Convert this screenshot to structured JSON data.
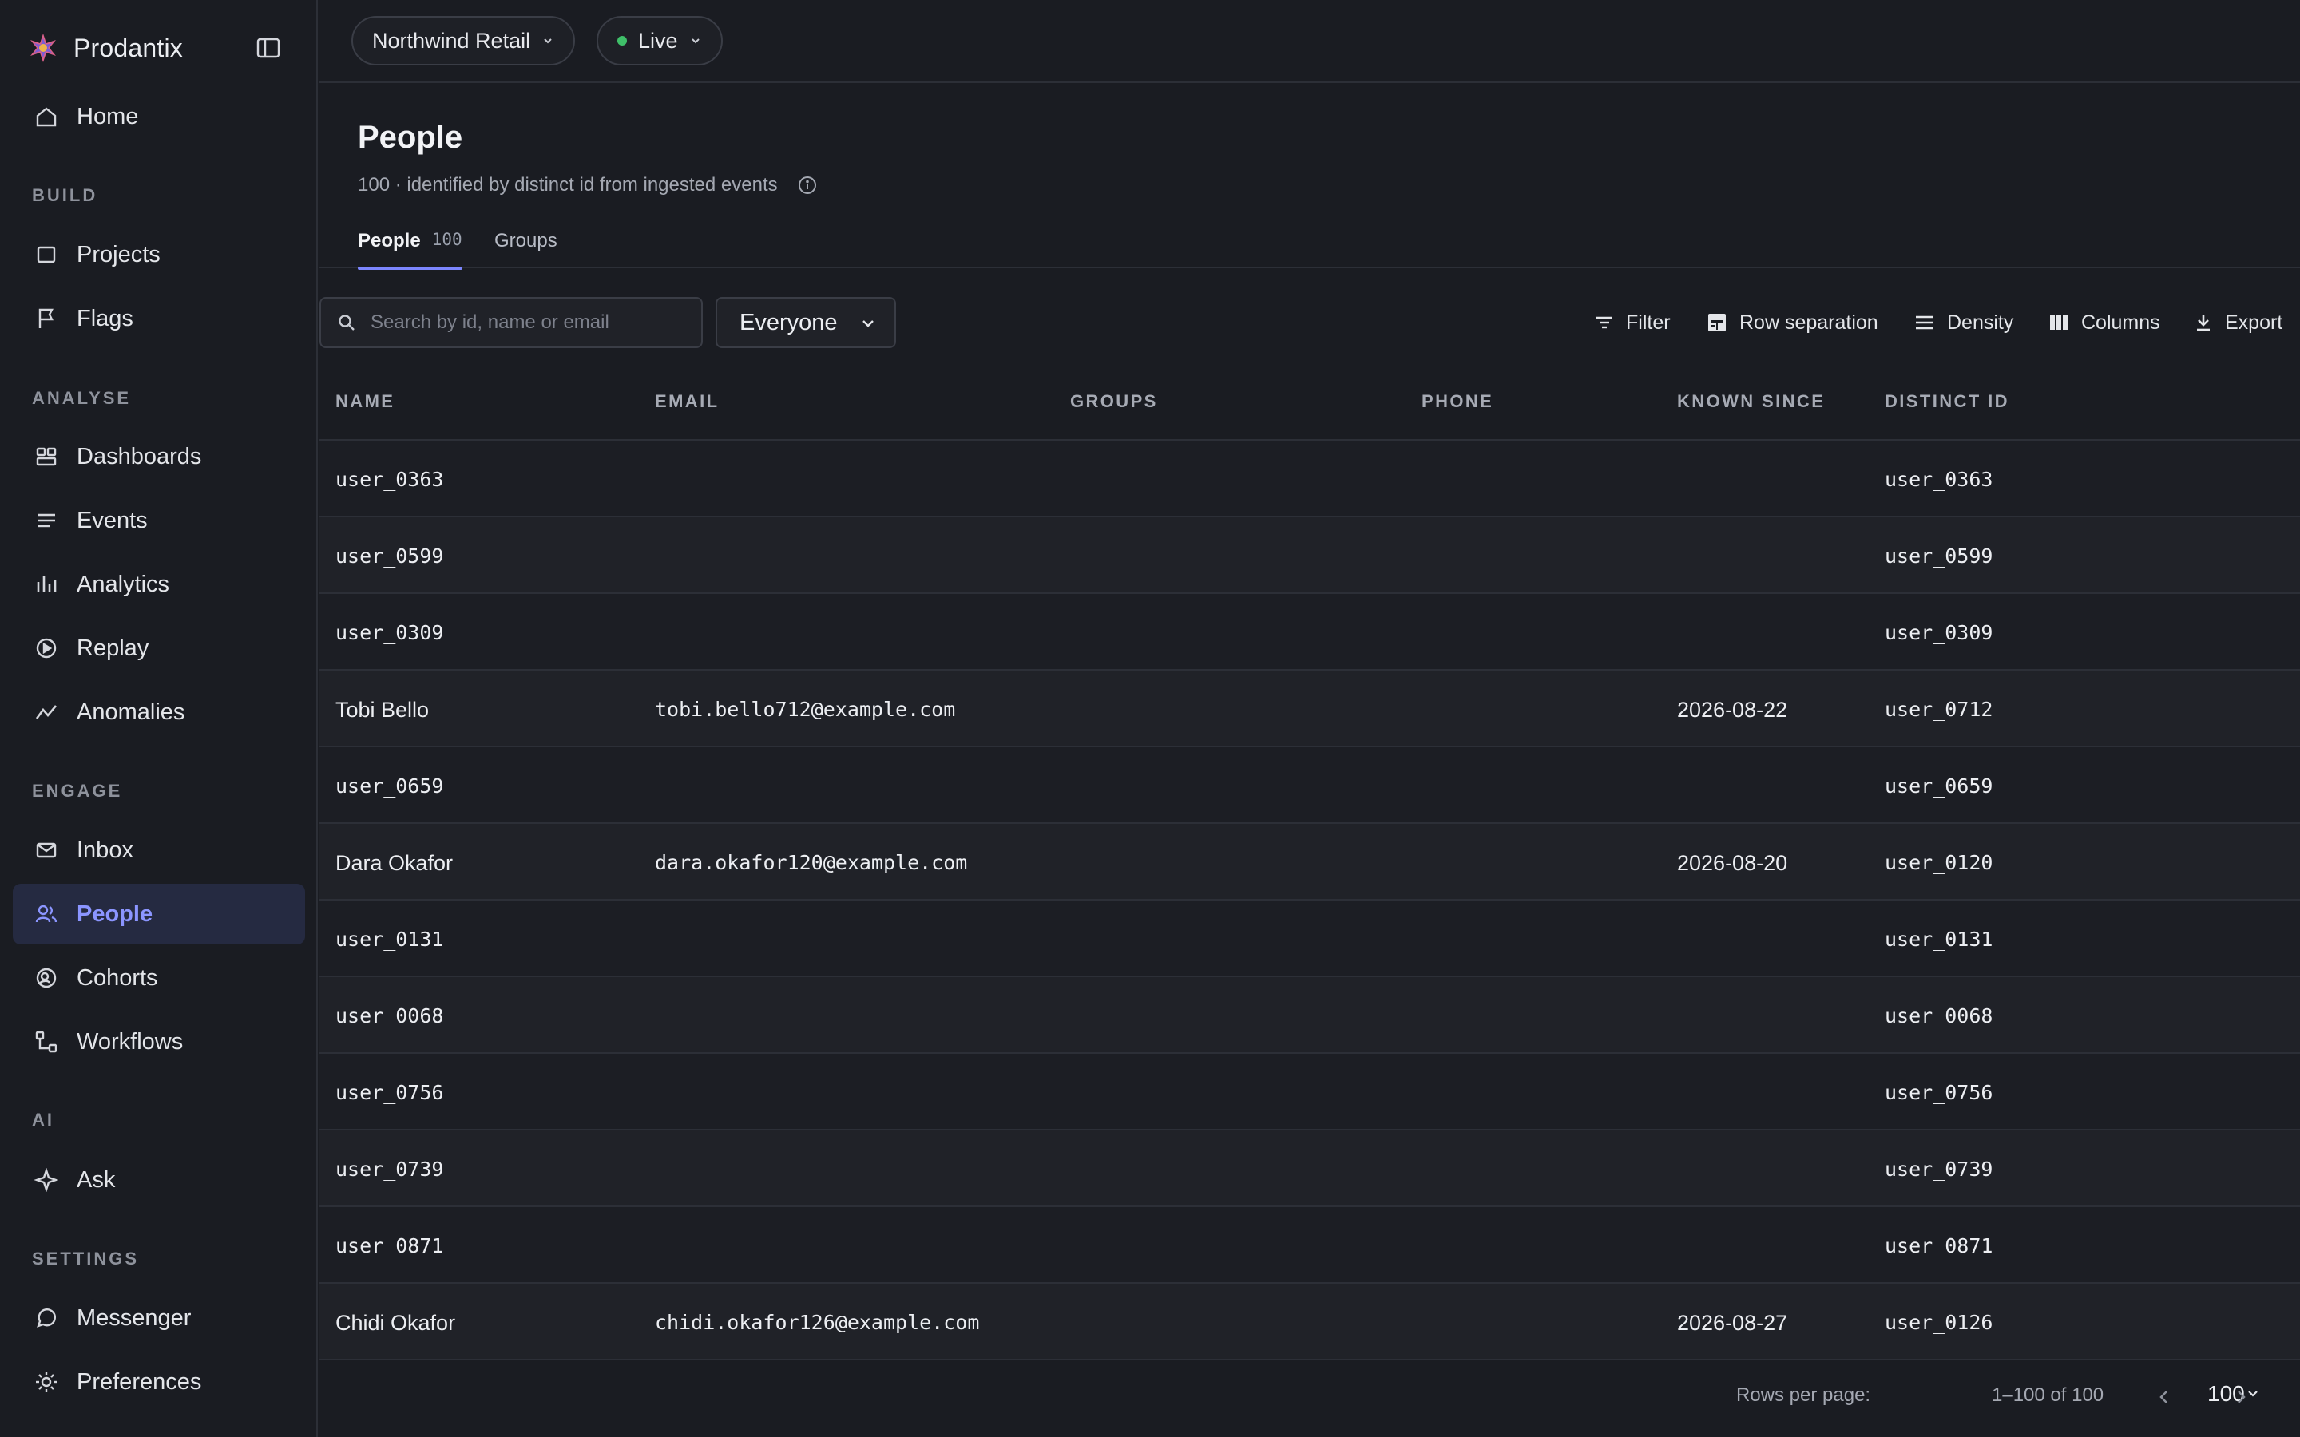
{
  "app": {
    "name": "Prodantix"
  },
  "sidebar": {
    "items": [
      {
        "label": "Home",
        "icon": "home-icon"
      }
    ],
    "sections": [
      {
        "label": "BUILD",
        "items": [
          {
            "label": "Projects",
            "icon": "square-icon"
          },
          {
            "label": "Flags",
            "icon": "flag-icon"
          }
        ]
      },
      {
        "label": "ANALYSE",
        "items": [
          {
            "label": "Dashboards",
            "icon": "dashboard-icon"
          },
          {
            "label": "Events",
            "icon": "list-icon"
          },
          {
            "label": "Analytics",
            "icon": "bar-chart-icon"
          },
          {
            "label": "Replay",
            "icon": "play-circle-icon"
          },
          {
            "label": "Anomalies",
            "icon": "trend-icon"
          }
        ]
      },
      {
        "label": "ENGAGE",
        "items": [
          {
            "label": "Inbox",
            "icon": "mail-icon"
          },
          {
            "label": "People",
            "icon": "people-icon",
            "active": true
          },
          {
            "label": "Cohorts",
            "icon": "cohort-icon"
          },
          {
            "label": "Workflows",
            "icon": "workflow-icon"
          }
        ]
      },
      {
        "label": "AI",
        "items": [
          {
            "label": "Ask",
            "icon": "sparkle-icon"
          }
        ]
      },
      {
        "label": "SETTINGS",
        "items": [
          {
            "label": "Messenger",
            "icon": "chat-icon"
          },
          {
            "label": "Preferences",
            "icon": "gear-icon"
          }
        ]
      }
    ]
  },
  "topbar": {
    "workspace": "Northwind Retail",
    "environment": "Live",
    "env_status_color": "#3fbf69"
  },
  "page": {
    "title": "People",
    "subtitle": "100 · identified by distinct id from ingested events",
    "tabs": [
      {
        "label": "People",
        "count": "100",
        "active": true
      },
      {
        "label": "Groups"
      }
    ]
  },
  "toolbar": {
    "search_placeholder": "Search by id, name or email",
    "segment": "Everyone",
    "filter": "Filter",
    "row_separation": "Row separation",
    "density": "Density",
    "columns": "Columns",
    "export": "Export"
  },
  "table": {
    "columns": [
      "NAME",
      "EMAIL",
      "GROUPS",
      "PHONE",
      "KNOWN SINCE",
      "DISTINCT ID"
    ],
    "rows": [
      {
        "name": "user_0363",
        "name_mono": true,
        "email": "",
        "groups": "",
        "phone": "",
        "known_since": "",
        "distinct_id": "user_0363"
      },
      {
        "name": "user_0599",
        "name_mono": true,
        "email": "",
        "groups": "",
        "phone": "",
        "known_since": "",
        "distinct_id": "user_0599"
      },
      {
        "name": "user_0309",
        "name_mono": true,
        "email": "",
        "groups": "",
        "phone": "",
        "known_since": "",
        "distinct_id": "user_0309"
      },
      {
        "name": "Tobi Bello",
        "name_mono": false,
        "email": "tobi.bello712@example.com",
        "groups": "",
        "phone": "",
        "known_since": "2026-08-22",
        "distinct_id": "user_0712"
      },
      {
        "name": "user_0659",
        "name_mono": true,
        "email": "",
        "groups": "",
        "phone": "",
        "known_since": "",
        "distinct_id": "user_0659"
      },
      {
        "name": "Dara Okafor",
        "name_mono": false,
        "email": "dara.okafor120@example.com",
        "groups": "",
        "phone": "",
        "known_since": "2026-08-20",
        "distinct_id": "user_0120"
      },
      {
        "name": "user_0131",
        "name_mono": true,
        "email": "",
        "groups": "",
        "phone": "",
        "known_since": "",
        "distinct_id": "user_0131"
      },
      {
        "name": "user_0068",
        "name_mono": true,
        "email": "",
        "groups": "",
        "phone": "",
        "known_since": "",
        "distinct_id": "user_0068"
      },
      {
        "name": "user_0756",
        "name_mono": true,
        "email": "",
        "groups": "",
        "phone": "",
        "known_since": "",
        "distinct_id": "user_0756"
      },
      {
        "name": "user_0739",
        "name_mono": true,
        "email": "",
        "groups": "",
        "phone": "",
        "known_since": "",
        "distinct_id": "user_0739"
      },
      {
        "name": "user_0871",
        "name_mono": true,
        "email": "",
        "groups": "",
        "phone": "",
        "known_since": "",
        "distinct_id": "user_0871"
      },
      {
        "name": "Chidi Okafor",
        "name_mono": false,
        "email": "chidi.okafor126@example.com",
        "groups": "",
        "phone": "",
        "known_since": "2026-08-27",
        "distinct_id": "user_0126"
      }
    ]
  },
  "pagination": {
    "rows_per_page_label": "Rows per page:",
    "rows_per_page": "100",
    "range": "1–100 of 100"
  },
  "colors": {
    "accent": "#7c86ff",
    "active_bg": "#252a41",
    "background": "#1a1c22"
  }
}
